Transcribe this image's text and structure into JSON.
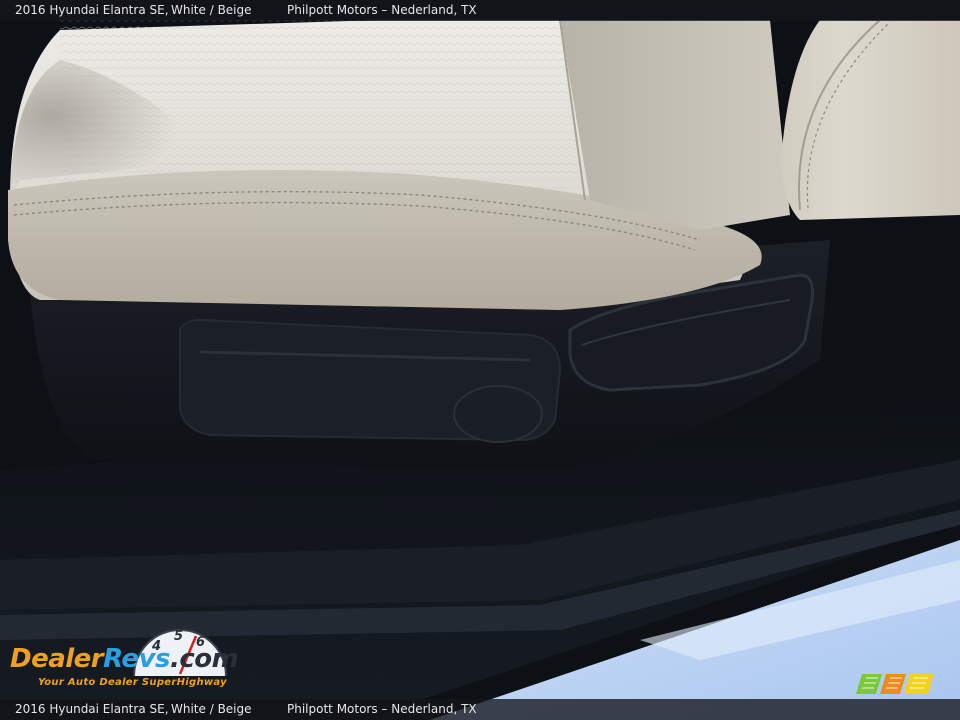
{
  "caption": {
    "vehicle": "2016 Hyundai Elantra SE,",
    "color": "White / Beige",
    "dealer": "Philpott Motors – Nederland, TX"
  },
  "logo": {
    "part1": "Dealer",
    "part2": "Revs",
    "part3": ".com",
    "tagline": "Your Auto Dealer SuperHighway",
    "dial_numbers": [
      "4",
      "5",
      "6"
    ]
  },
  "colors": {
    "logo_orange": "#f0a020",
    "logo_blue": "#2a9ee0",
    "caption_bar": "#14161c",
    "seat_beige": "#cfc9bd",
    "trim_dark": "#15181e"
  }
}
